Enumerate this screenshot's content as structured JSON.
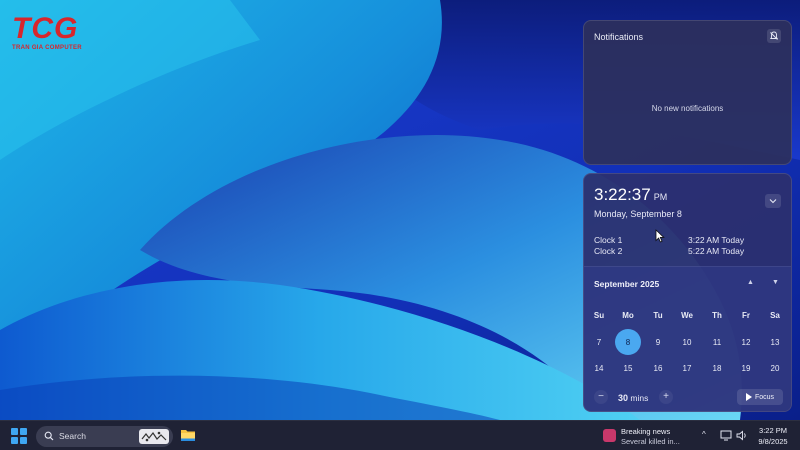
{
  "logo": {
    "letters": "TCG",
    "subtitle": "TRAN GIA COMPUTER"
  },
  "notifications": {
    "title": "Notifications",
    "empty_text": "No new notifications",
    "dnd_icon": "bell-slash-icon"
  },
  "clock": {
    "time": "3:22:37",
    "ampm": "PM",
    "date": "Monday, September 8",
    "world_clocks": [
      {
        "name": "Clock 1",
        "time": "3:22 AM Today"
      },
      {
        "name": "Clock 2",
        "time": "5:22 AM Today"
      }
    ]
  },
  "calendar": {
    "month_title": "September 2025",
    "up_icon": "▲",
    "down_icon": "▼",
    "weekdays": [
      "Su",
      "Mo",
      "Tu",
      "We",
      "Th",
      "Fr",
      "Sa"
    ],
    "week_rows": [
      [
        "7",
        "8",
        "9",
        "10",
        "11",
        "12",
        "13"
      ],
      [
        "14",
        "15",
        "16",
        "17",
        "18",
        "19",
        "20"
      ]
    ],
    "today": "8"
  },
  "focus": {
    "minus": "−",
    "plus": "+",
    "minutes_value": "30",
    "minutes_unit": "mins",
    "button_label": "Focus"
  },
  "taskbar": {
    "search_label": "Search",
    "news_title": "Breaking news",
    "news_subtitle": "Several killed in...",
    "tray_chevron": "^",
    "time": "3:22 PM",
    "date": "9/8/2025"
  },
  "colors": {
    "accent": "#4aa8f0",
    "taskbar": "#1f2235",
    "logo_red": "#d8262c"
  }
}
